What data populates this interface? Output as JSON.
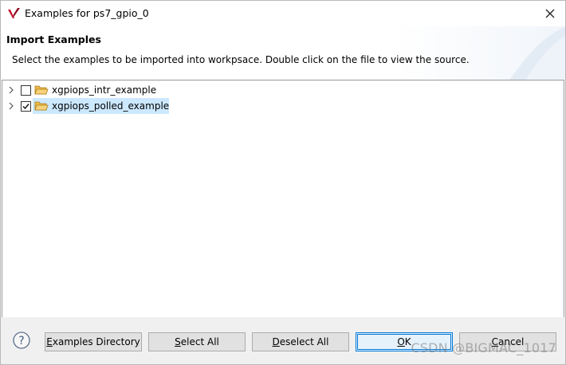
{
  "window": {
    "title": "Examples for ps7_gpio_0"
  },
  "header": {
    "title": "Import Examples",
    "description": "Select the examples to be imported into workpsace. Double click on the file to view the source."
  },
  "tree": {
    "items": [
      {
        "label": "xgpiops_intr_example",
        "checked": false,
        "selected": false
      },
      {
        "label": "xgpiops_polled_example",
        "checked": true,
        "selected": true
      }
    ]
  },
  "footer": {
    "examples_directory": {
      "mnemonic": "E",
      "rest": "xamples Directory"
    },
    "select_all": {
      "mnemonic": "S",
      "rest": "elect All"
    },
    "deselect_all": {
      "mnemonic": "D",
      "rest": "eselect All"
    },
    "ok": {
      "mnemonic": "O",
      "rest": "K"
    },
    "cancel": {
      "mnemonic": "C",
      "rest": "ancel"
    }
  },
  "watermark": "CSDN @BIGMAC_1017",
  "colors": {
    "accent": "#0078d7",
    "selection": "#cce8ff",
    "folder": "#e8b84a",
    "vivado_red": "#c8102e"
  },
  "icons": {
    "app": "vivado-logo-icon",
    "close": "close-icon",
    "expand": "chevron-right-icon",
    "folder": "folder-open-icon",
    "help": "help-icon"
  }
}
